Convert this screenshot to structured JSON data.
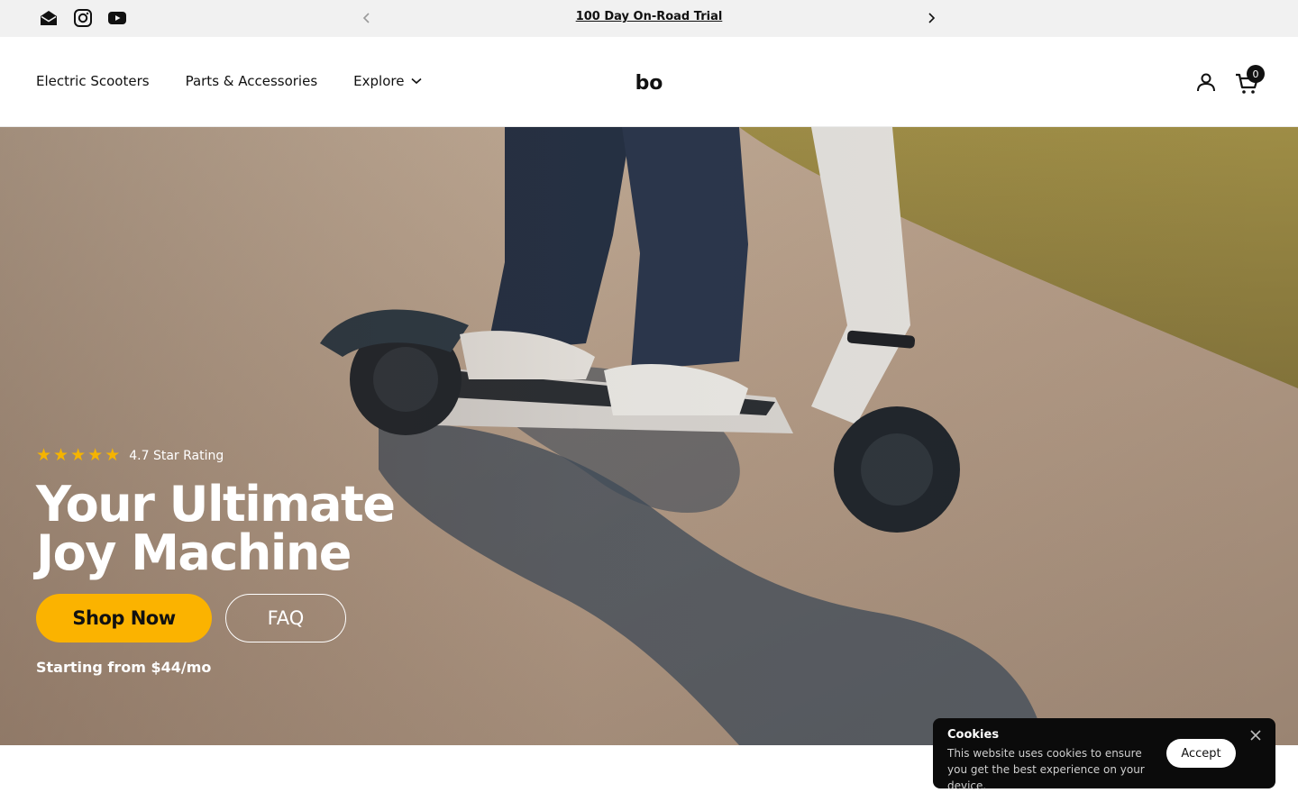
{
  "announcement": {
    "text": "100 Day On-Road Trial",
    "social_icons": [
      "email-icon",
      "instagram-icon",
      "youtube-icon"
    ],
    "prev_icon": "chevron-left-icon",
    "next_icon": "chevron-right-icon"
  },
  "header": {
    "nav": [
      {
        "label": "Electric Scooters"
      },
      {
        "label": "Parts & Accessories"
      },
      {
        "label": "Explore",
        "icon": "chevron-down-icon"
      }
    ],
    "logo_text": "bo",
    "account_icon": "user-icon",
    "cart_icon": "cart-icon",
    "cart_count": "0"
  },
  "hero": {
    "rating_stars": 5,
    "rating_text": "4.7 Star Rating",
    "headline_line1": "Your Ultimate",
    "headline_line2": "Joy Machine",
    "shop_button": "Shop Now",
    "faq_button": "FAQ",
    "price_note": "Starting from $44/mo",
    "image": "rider-on-electric-scooter-photo"
  },
  "cookie": {
    "title": "Cookies",
    "message": "This website uses cookies to ensure you get the best experience on your device.",
    "accept_label": "Accept",
    "close_icon": "close-icon"
  },
  "colors": {
    "accent": "#fbb300",
    "star": "#f5b400",
    "announcement_bg": "#f1f1f1",
    "cookie_bg": "#0b0b0b"
  }
}
